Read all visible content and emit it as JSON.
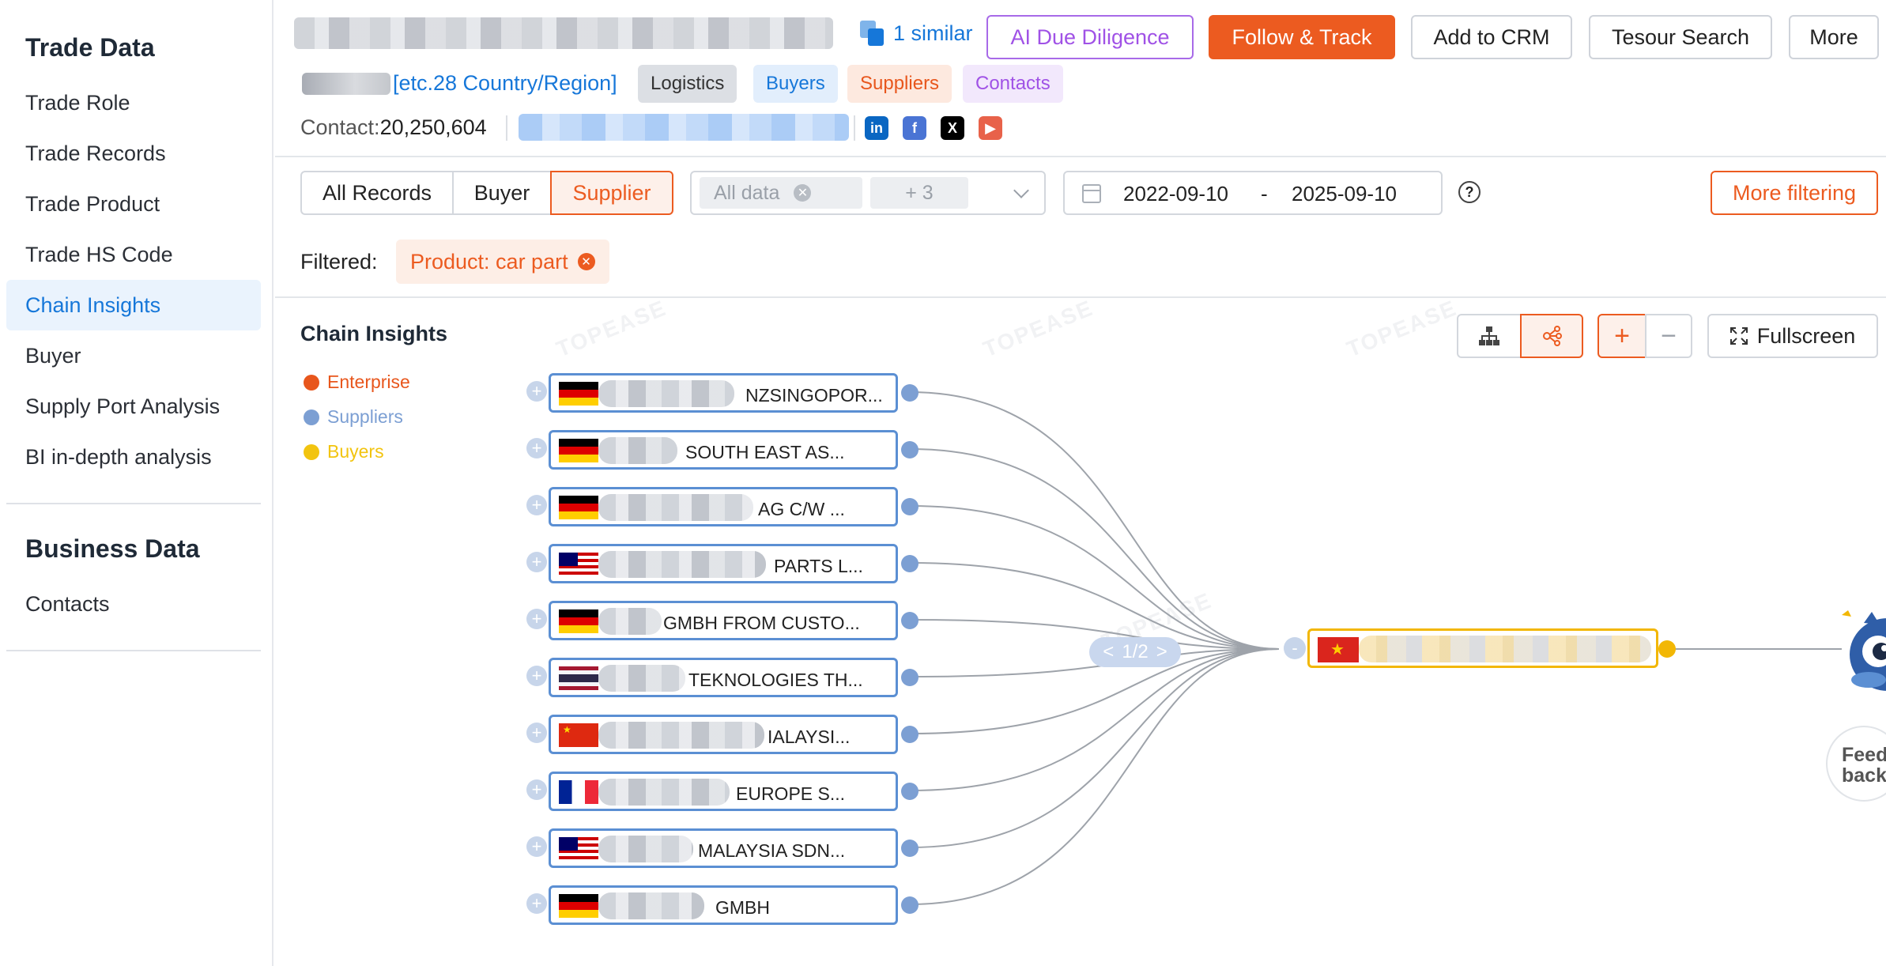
{
  "sidebar": {
    "sections": [
      {
        "title": "Trade Data",
        "items": [
          "Trade Role",
          "Trade Records",
          "Trade Product",
          "Trade HS Code",
          "Chain Insights",
          "Buyer",
          "Supply Port Analysis",
          "BI in-depth analysis"
        ]
      },
      {
        "title": "Business Data",
        "items": [
          "Contacts"
        ]
      }
    ],
    "active_item": "Chain Insights"
  },
  "header": {
    "similar_label": "1 similar",
    "buttons": {
      "ai_due_diligence": "AI Due Diligence",
      "follow_track": "Follow & Track",
      "add_to_crm": "Add to CRM",
      "tesour_search": "Tesour Search",
      "more": "More"
    },
    "location_text": "[etc.28 Country/Region]",
    "tags": {
      "logistics": "Logistics",
      "buyers": "Buyers",
      "suppliers": "Suppliers",
      "contacts": "Contacts"
    },
    "contact_label": "Contact:",
    "contact_value": "20,250,604",
    "social_icons": [
      "linkedin-icon",
      "facebook-icon",
      "x-twitter-icon",
      "youtube-icon"
    ]
  },
  "filters": {
    "segments": {
      "all_records": "All Records",
      "buyer": "Buyer",
      "supplier": "Supplier"
    },
    "active_segment": "Supplier",
    "data_select": {
      "value": "All data",
      "extra_count": "+ 3"
    },
    "date_start": "2022-09-10",
    "date_separator": "-",
    "date_end": "2025-09-10",
    "help_symbol": "?",
    "more_filtering": "More filtering",
    "filtered_label": "Filtered:",
    "filtered_tag": "Product:  car part"
  },
  "chain": {
    "title": "Chain Insights",
    "legend": {
      "enterprise": "Enterprise",
      "suppliers": "Suppliers",
      "buyers": "Buyers"
    },
    "legend_colors": {
      "enterprise": "#e8561c",
      "suppliers": "#7c9fd3",
      "buyers": "#f2c40f"
    },
    "fullscreen_label": "Fullscreen",
    "pager": {
      "prev": "<",
      "page": "1/2",
      "next": ">"
    },
    "suppliers": [
      {
        "country": "germany",
        "label": "NZSINGOPOR..."
      },
      {
        "country": "germany",
        "label": "SOUTH EAST AS..."
      },
      {
        "country": "germany",
        "label": "AG C/W ..."
      },
      {
        "country": "malaysia",
        "label": "PARTS L..."
      },
      {
        "country": "germany",
        "label": "GMBH FROM CUSTO..."
      },
      {
        "country": "thailand",
        "label": "TEKNOLOGIES TH..."
      },
      {
        "country": "china",
        "label": "IALAYSI..."
      },
      {
        "country": "france",
        "label": "EUROPE S..."
      },
      {
        "country": "malaysia",
        "label": "MALAYSIA SDN..."
      },
      {
        "country": "germany",
        "label": "GMBH"
      }
    ],
    "center_country": "vietnam",
    "feedback_label": "Feed back"
  }
}
